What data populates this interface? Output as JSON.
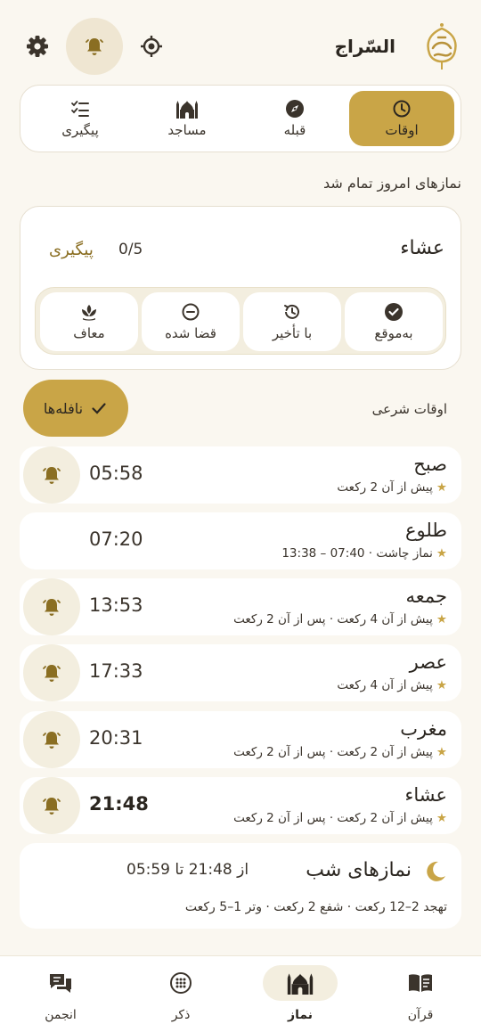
{
  "app": {
    "title": "السّراج"
  },
  "colors": {
    "accent": "#c9a547",
    "background": "#faf7f0",
    "soft": "#f3eedf",
    "text": "#2b2620"
  },
  "header": {
    "icons": [
      "logo",
      "location-icon",
      "bell-icon",
      "gear-icon"
    ]
  },
  "tabs": [
    {
      "label": "اوقات",
      "icon": "clock-icon",
      "active": true
    },
    {
      "label": "قبله",
      "icon": "compass-icon",
      "active": false
    },
    {
      "label": "مساجد",
      "icon": "mosque-icon",
      "active": false
    },
    {
      "label": "پیگیری",
      "icon": "checklist-icon",
      "active": false
    }
  ],
  "status_message": "نمازهای امروز تمام شد",
  "current_prayer": {
    "name": "عشاء",
    "count": "0/5",
    "tracking_label": "پیگیری",
    "statuses": [
      {
        "label": "به‌موقع",
        "icon": "check-circle-icon"
      },
      {
        "label": "با تأخیر",
        "icon": "history-icon"
      },
      {
        "label": "قضا شده",
        "icon": "minus-circle-icon"
      },
      {
        "label": "معاف",
        "icon": "lotus-icon"
      }
    ]
  },
  "section": {
    "label": "اوقات شرعی",
    "nafila_label": "نافله‌ها"
  },
  "prayers": [
    {
      "name": "صبح",
      "time": "05:58",
      "note": "پیش از آن 2 رکعت",
      "bell": true
    },
    {
      "name": "طلوع",
      "time": "07:20",
      "note": "نماز چاشت · 07:40 – 13:38",
      "bell": false
    },
    {
      "name": "جمعه",
      "time": "13:53",
      "note": "پیش از آن 4 رکعت · پس از آن 2 رکعت",
      "bell": true
    },
    {
      "name": "عصر",
      "time": "17:33",
      "note": "پیش از آن 4 رکعت",
      "bell": true
    },
    {
      "name": "مغرب",
      "time": "20:31",
      "note": "پیش از آن 2 رکعت · پس از آن 2 رکعت",
      "bell": true
    },
    {
      "name": "عشاء",
      "time": "21:48",
      "note": "پیش از آن 2 رکعت · پس از آن 2 رکعت",
      "bell": true
    }
  ],
  "night_prayers": {
    "title": "نمازهای شب",
    "range": "از 21:48 تا 05:59",
    "desc": "تهجد 2–12 رکعت · شفع 2 رکعت · وتر 1–5 رکعت"
  },
  "bottom_nav": [
    {
      "label": "قرآن",
      "icon": "book-icon",
      "active": false
    },
    {
      "label": "نماز",
      "icon": "mosque-icon",
      "active": true
    },
    {
      "label": "ذکر",
      "icon": "prayer-beads-icon",
      "active": false
    },
    {
      "label": "انجمن",
      "icon": "chat-icon",
      "active": false
    }
  ]
}
